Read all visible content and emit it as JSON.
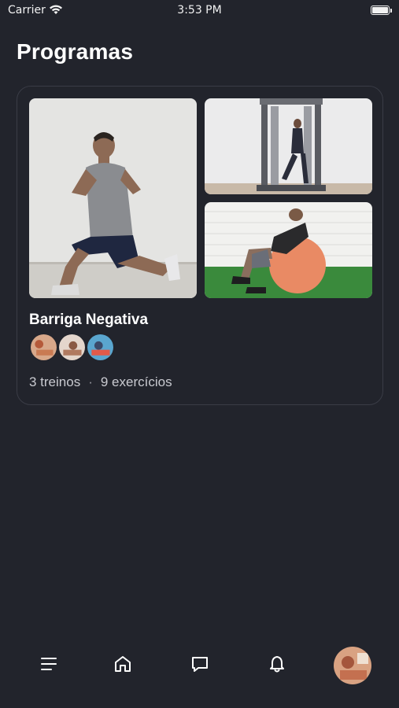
{
  "status_bar": {
    "carrier": "Carrier",
    "time": "3:53 PM",
    "battery_level": 1.0
  },
  "page": {
    "title": "Programas"
  },
  "program": {
    "name": "Barriga Negativa",
    "workouts": "3 treinos",
    "separator": "·",
    "exercises": "9 exercícios",
    "images": [
      "lunge-exercise-photo",
      "cable-machine-exercise-photo",
      "stability-ball-crunch-photo"
    ],
    "workout_avatars": [
      "workout-thumbnail-1",
      "workout-thumbnail-2",
      "workout-thumbnail-3"
    ]
  },
  "bottom_nav": {
    "items": [
      "menu-icon",
      "home-icon",
      "chat-icon",
      "bell-icon",
      "profile-avatar"
    ]
  },
  "colors": {
    "background": "#22242c",
    "card_border": "#3a3c46",
    "text_primary": "#ffffff",
    "text_secondary": "#c9cad0"
  }
}
